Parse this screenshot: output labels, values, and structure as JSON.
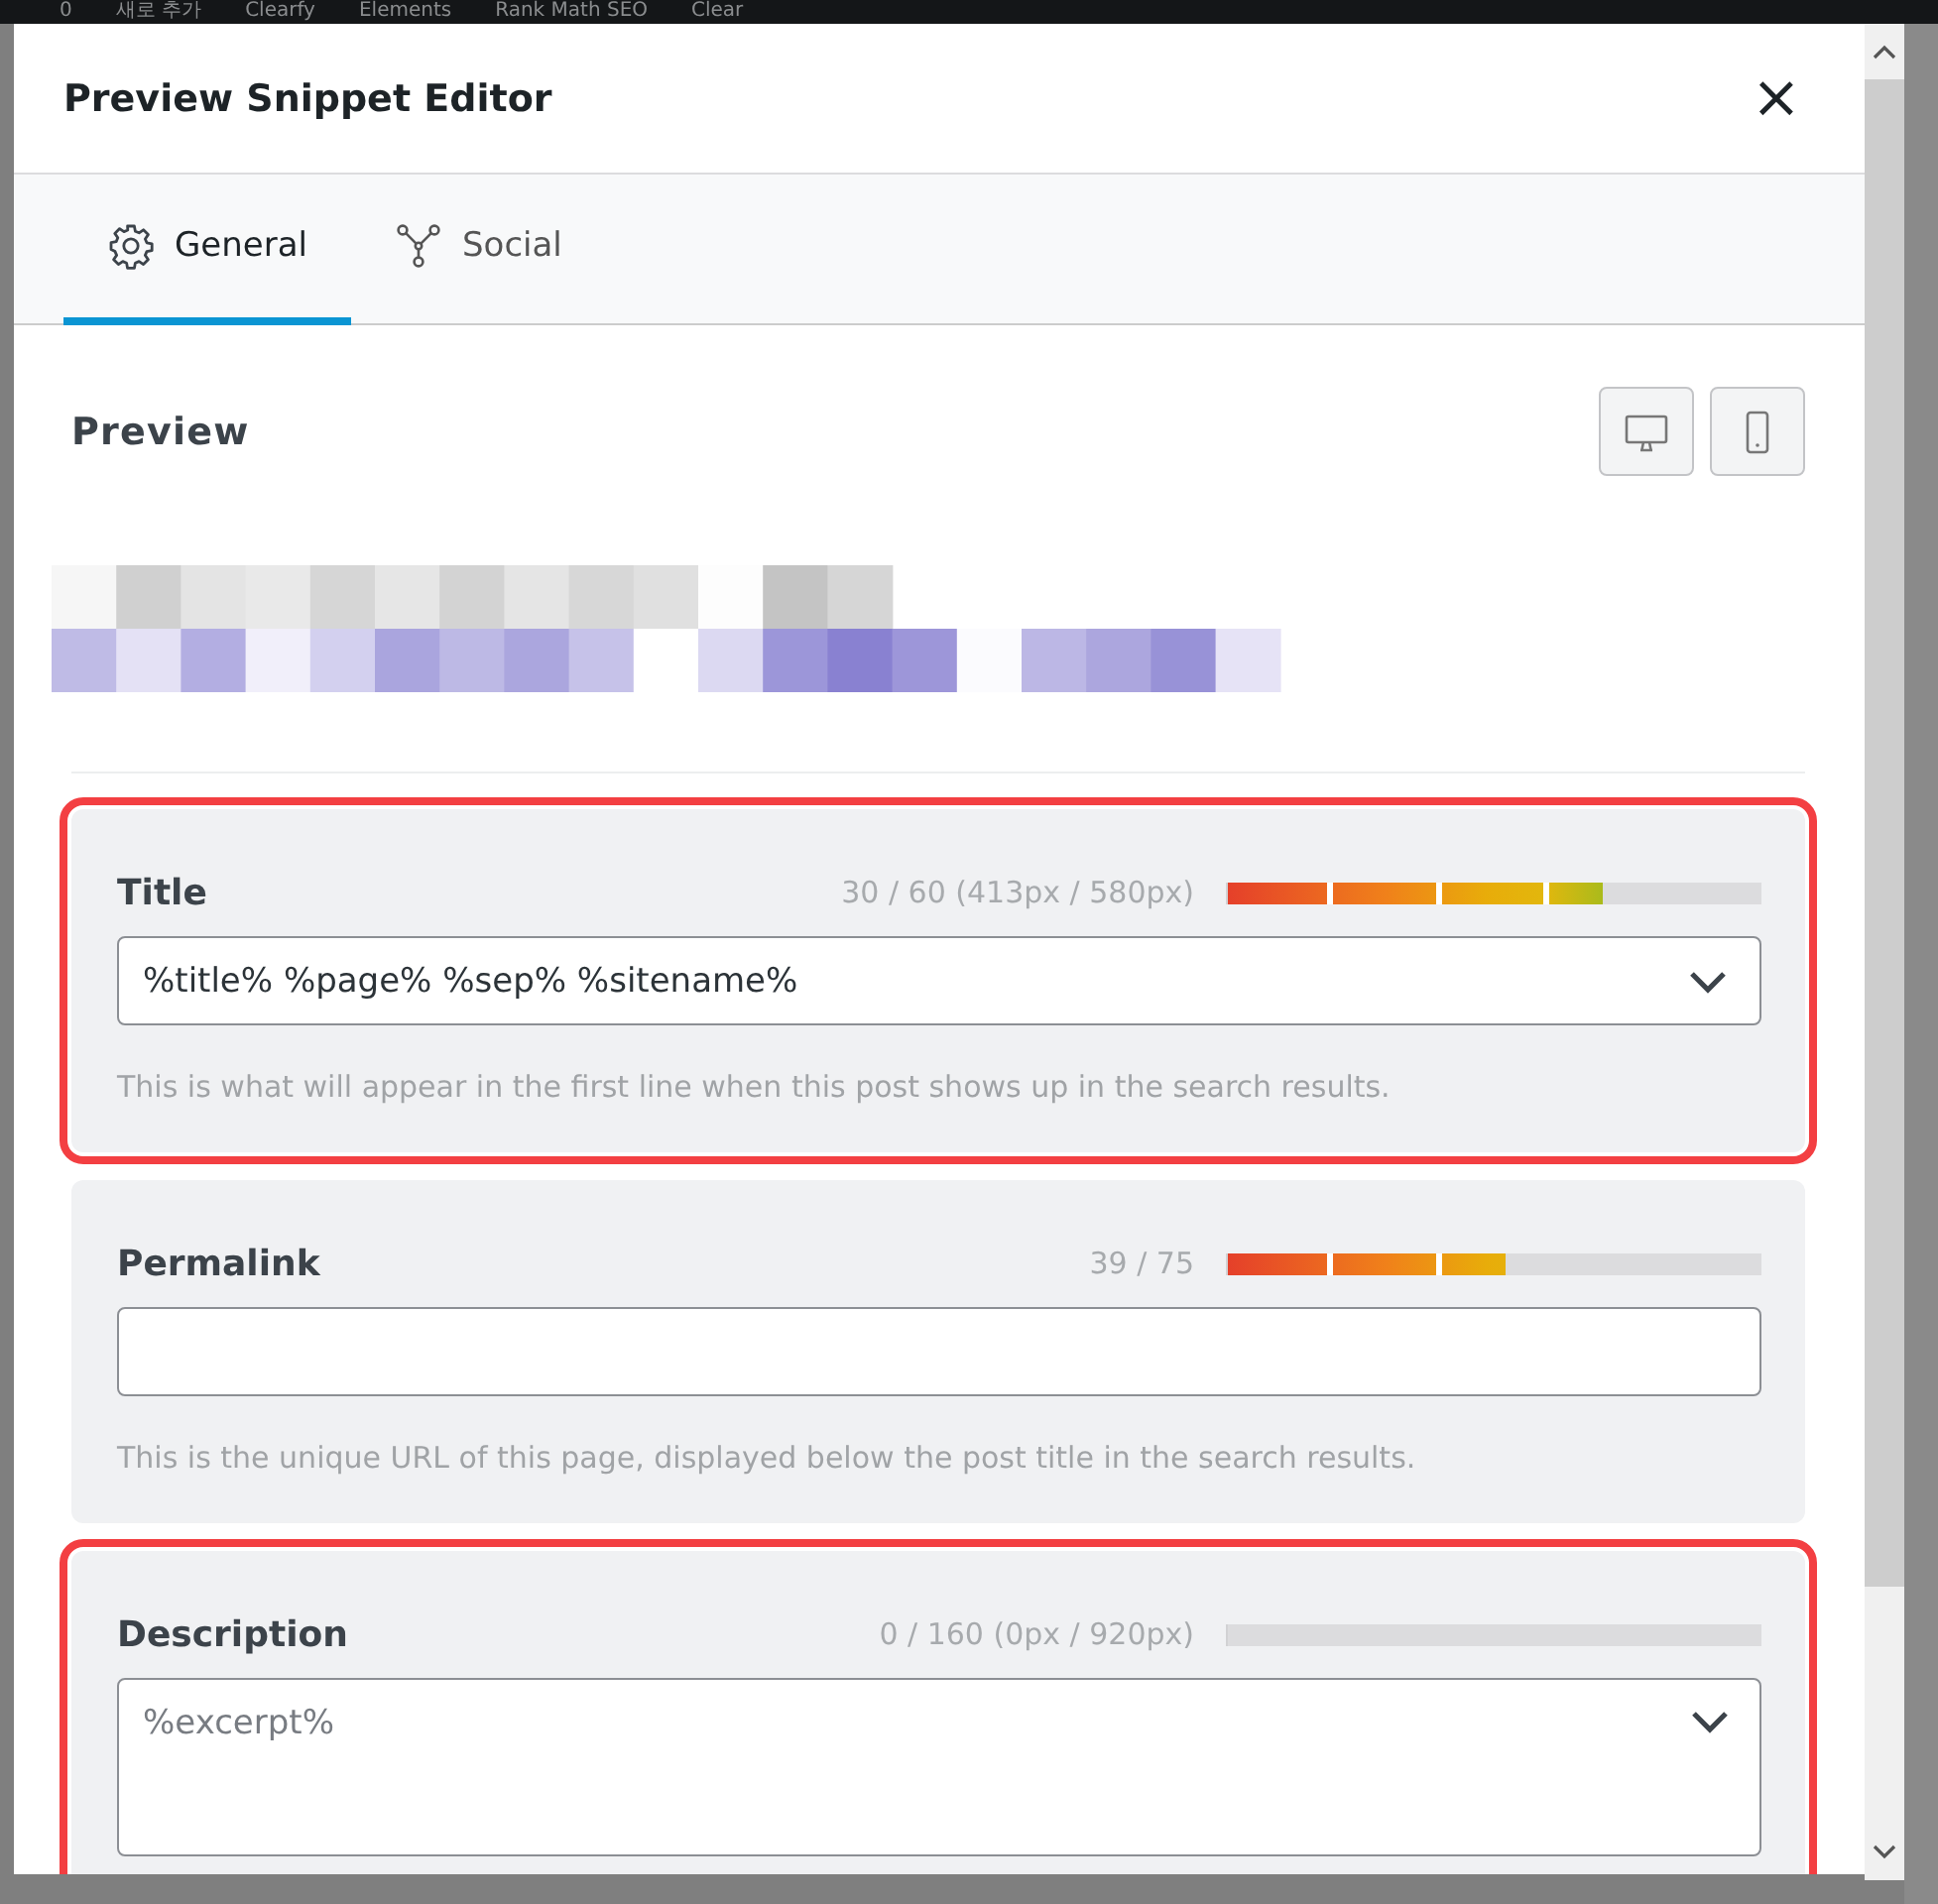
{
  "admin_bar": {
    "items": [
      "0",
      "새로 추가",
      "Clearfy",
      "Elements",
      "Rank Math SEO",
      "Clear"
    ]
  },
  "dialog": {
    "title": "Preview Snippet Editor",
    "close": "×"
  },
  "tabs": [
    {
      "label": "General",
      "kind": "gear",
      "selected": true
    },
    {
      "label": "Social",
      "kind": "social",
      "selected": false
    }
  ],
  "preview": {
    "heading": "Preview"
  },
  "fields": [
    {
      "label": "Title",
      "counter": "30 / 60 (413px / 580px)",
      "level": 0.7,
      "kind": "select",
      "value": "%title% %page% %sep% %sitename%",
      "help": "This is what will appear in the first line when this post shows up in the search results.",
      "highlighted": true
    },
    {
      "label": "Permalink",
      "counter": "39 / 75",
      "level": 0.52,
      "kind": "text",
      "help": "This is the unique URL of this page, displayed below the post title in the search results.",
      "highlighted": false
    },
    {
      "label": "Description",
      "counter": "0 / 160 (0px / 920px)",
      "level": 0,
      "kind": "textarea",
      "placeholder": "%excerpt%",
      "highlighted": true
    }
  ]
}
